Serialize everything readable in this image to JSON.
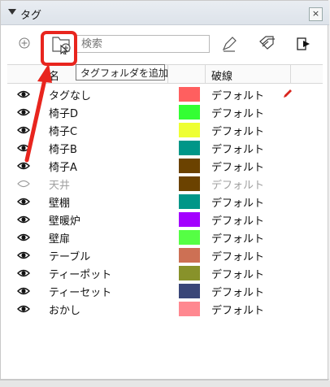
{
  "panel": {
    "title": "タグ",
    "close_label": "×"
  },
  "toolbar": {
    "search_placeholder": "検索",
    "buttons": [
      "add-tag",
      "add-tag-folder",
      "color-by-tag",
      "dashed-line-tag",
      "export"
    ]
  },
  "tooltip": "タグフォルダを追加",
  "columns": {
    "name": "名",
    "linetype": "破線"
  },
  "rows": [
    {
      "name": "タグなし",
      "color": "#ff5f5f",
      "linetype": "デフォルト",
      "visible": true,
      "editing": true
    },
    {
      "name": "椅子D",
      "color": "#33ff33",
      "linetype": "デフォルト",
      "visible": true
    },
    {
      "name": "椅子C",
      "color": "#eeff33",
      "linetype": "デフォルト",
      "visible": true
    },
    {
      "name": "椅子B",
      "color": "#009688",
      "linetype": "デフォルト",
      "visible": true
    },
    {
      "name": "椅子A",
      "color": "#6b4200",
      "linetype": "デフォルト",
      "visible": true
    },
    {
      "name": "天井",
      "color": "#6b4200",
      "linetype": "デフォルト",
      "visible": false
    },
    {
      "name": "壁棚",
      "color": "#009688",
      "linetype": "デフォルト",
      "visible": true
    },
    {
      "name": "壁暖炉",
      "color": "#a300ff",
      "linetype": "デフォルト",
      "visible": true
    },
    {
      "name": "壁扉",
      "color": "#55ff44",
      "linetype": "デフォルト",
      "visible": true
    },
    {
      "name": "テーブル",
      "color": "#cd7054",
      "linetype": "デフォルト",
      "visible": true
    },
    {
      "name": "ティーポット",
      "color": "#88922a",
      "linetype": "デフォルト",
      "visible": true
    },
    {
      "name": "ティーセット",
      "color": "#3a4678",
      "linetype": "デフォルト",
      "visible": true
    },
    {
      "name": "おかし",
      "color": "#ff8890",
      "linetype": "デフォルト",
      "visible": true
    }
  ],
  "colors": {
    "highlight": "#e8251e",
    "pencil": "#d9251d"
  }
}
